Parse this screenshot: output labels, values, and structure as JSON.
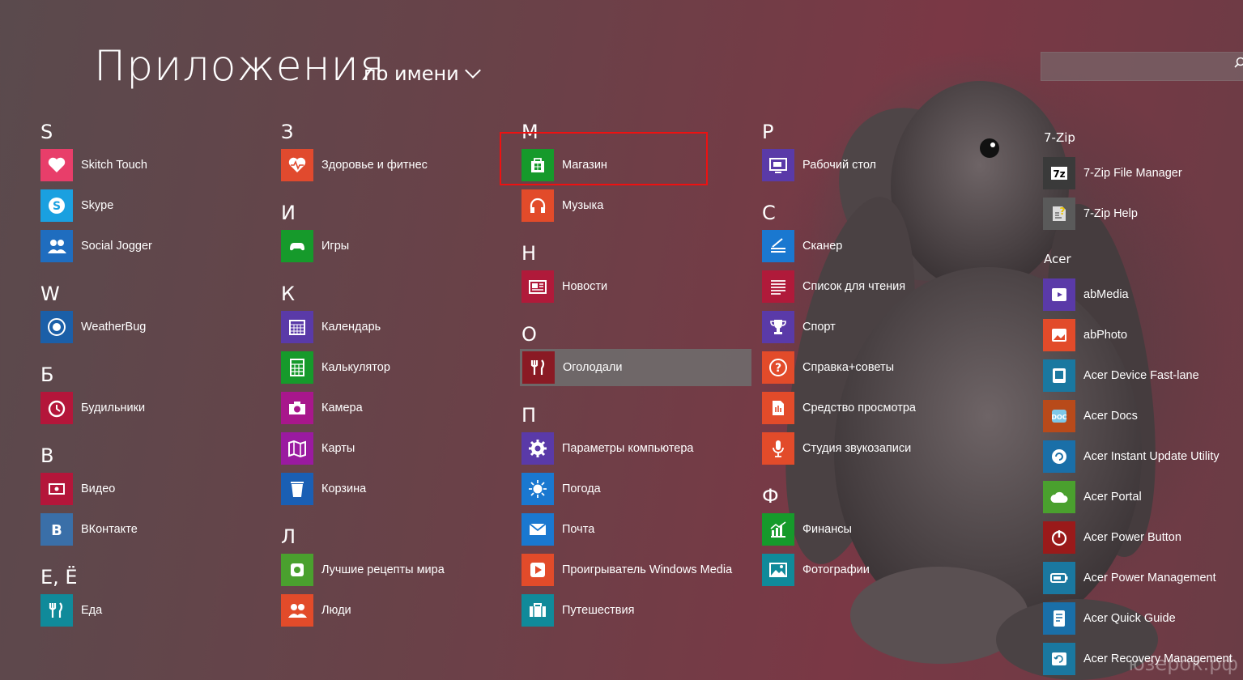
{
  "header": {
    "title": "Приложения",
    "sort_label": "по имени"
  },
  "search": {
    "placeholder": ""
  },
  "watermark": "юзерок.рф",
  "columns": [
    {
      "groups": [
        {
          "letter": "S",
          "apps": [
            {
              "label": "Skitch Touch",
              "color": "#e83e6a",
              "icon": "heart-icon"
            },
            {
              "label": "Skype",
              "color": "#1aa0e0",
              "icon": "skype-icon"
            },
            {
              "label": "Social Jogger",
              "color": "#1f6dbf",
              "icon": "people-icon"
            }
          ]
        },
        {
          "letter": "W",
          "apps": [
            {
              "label": "WeatherBug",
              "color": "#1b5fa8",
              "icon": "weatherbug-icon"
            }
          ]
        },
        {
          "letter": "Б",
          "apps": [
            {
              "label": "Будильники",
              "color": "#b4163a",
              "icon": "alarm-icon"
            }
          ]
        },
        {
          "letter": "В",
          "apps": [
            {
              "label": "Видео",
              "color": "#b4163a",
              "icon": "video-icon"
            },
            {
              "label": "ВКонтакте",
              "color": "#3a6fa8",
              "icon": "vk-icon"
            }
          ]
        },
        {
          "letter": "Е, Ё",
          "apps": [
            {
              "label": "Еда",
              "color": "#108a9a",
              "icon": "fork-knife-icon"
            }
          ]
        }
      ]
    },
    {
      "groups": [
        {
          "letter": "З",
          "apps": [
            {
              "label": "Здоровье и фитнес",
              "color": "#e14a2e",
              "icon": "heart-pulse-icon"
            }
          ]
        },
        {
          "letter": "И",
          "apps": [
            {
              "label": "Игры",
              "color": "#169a2b",
              "icon": "gamepad-icon"
            }
          ]
        },
        {
          "letter": "К",
          "apps": [
            {
              "label": "Календарь",
              "color": "#5a3aa8",
              "icon": "calendar-icon"
            },
            {
              "label": "Калькулятор",
              "color": "#169a2b",
              "icon": "calculator-icon"
            },
            {
              "label": "Камера",
              "color": "#a8178c",
              "icon": "camera-icon"
            },
            {
              "label": "Карты",
              "color": "#9a1aa0",
              "icon": "map-icon"
            },
            {
              "label": "Корзина",
              "color": "#1a5fb4",
              "icon": "recycle-bin-icon"
            }
          ]
        },
        {
          "letter": "Л",
          "apps": [
            {
              "label": "Лучшие рецепты мира",
              "color": "#4aa02e",
              "icon": "recipes-icon"
            },
            {
              "label": "Люди",
              "color": "#e24b2a",
              "icon": "people-icon"
            }
          ]
        }
      ]
    },
    {
      "groups": [
        {
          "letter": "М",
          "apps": [
            {
              "label": "Магазин",
              "color": "#169a2b",
              "icon": "store-icon"
            },
            {
              "label": "Музыка",
              "color": "#e24b2a",
              "icon": "headphones-icon"
            }
          ]
        },
        {
          "letter": "Н",
          "apps": [
            {
              "label": "Новости",
              "color": "#b01a3a",
              "icon": "news-icon"
            }
          ]
        },
        {
          "letter": "О",
          "apps": [
            {
              "label": "Оголодали",
              "color": "#8a1a24",
              "icon": "fork-knife-icon"
            }
          ]
        },
        {
          "letter": "П",
          "apps": [
            {
              "label": "Параметры компьютера",
              "color": "#5a3aa8",
              "icon": "gear-icon"
            },
            {
              "label": "Погода",
              "color": "#1a78d0",
              "icon": "sun-icon"
            },
            {
              "label": "Почта",
              "color": "#1a78d0",
              "icon": "mail-icon"
            },
            {
              "label": "Проигрыватель Windows Media",
              "color": "#e24b2a",
              "icon": "media-player-icon"
            },
            {
              "label": "Путешествия",
              "color": "#108a9a",
              "icon": "suitcase-icon"
            }
          ]
        }
      ]
    },
    {
      "groups": [
        {
          "letter": "Р",
          "apps": [
            {
              "label": "Рабочий стол",
              "color": "#5a3aa8",
              "icon": "desktop-icon"
            }
          ]
        },
        {
          "letter": "С",
          "apps": [
            {
              "label": "Сканер",
              "color": "#1a78d0",
              "icon": "scanner-icon"
            },
            {
              "label": "Список для чтения",
              "color": "#b01a3a",
              "icon": "reading-list-icon"
            },
            {
              "label": "Спорт",
              "color": "#5a3aa8",
              "icon": "trophy-icon"
            },
            {
              "label": "Справка+советы",
              "color": "#e24b2a",
              "icon": "help-icon"
            },
            {
              "label": "Средство просмотра",
              "color": "#e24b2a",
              "icon": "reader-icon"
            },
            {
              "label": "Студия звукозаписи",
              "color": "#e24b2a",
              "icon": "microphone-icon"
            }
          ]
        },
        {
          "letter": "Ф",
          "apps": [
            {
              "label": "Финансы",
              "color": "#169a2b",
              "icon": "finance-icon"
            },
            {
              "label": "Фотографии",
              "color": "#108a9a",
              "icon": "photos-icon"
            }
          ]
        }
      ]
    },
    {
      "groups": [
        {
          "letter": "7-Zip",
          "apps": [
            {
              "label": "7-Zip File Manager",
              "color": "#3a3a3a",
              "icon": "7zip-icon"
            },
            {
              "label": "7-Zip Help",
              "color": "#5a5a5a",
              "icon": "help-doc-icon"
            }
          ]
        },
        {
          "letter": "Acer",
          "apps": [
            {
              "label": "abMedia",
              "color": "#5a3aa8",
              "icon": "media-icon"
            },
            {
              "label": "abPhoto",
              "color": "#e24b2a",
              "icon": "photo-icon"
            },
            {
              "label": "Acer Device Fast-lane",
              "color": "#1a78a0",
              "icon": "device-icon"
            },
            {
              "label": "Acer Docs",
              "color": "#b84a1a",
              "icon": "docs-icon"
            },
            {
              "label": "Acer Instant Update Utility",
              "color": "#1a6fa8",
              "icon": "update-icon"
            },
            {
              "label": "Acer Portal",
              "color": "#4aa02e",
              "icon": "cloud-icon"
            },
            {
              "label": "Acer Power Button",
              "color": "#9a1a1a",
              "icon": "power-icon"
            },
            {
              "label": "Acer Power Management",
              "color": "#1a78a0",
              "icon": "battery-icon"
            },
            {
              "label": "Acer Quick Guide",
              "color": "#1a6fa8",
              "icon": "guide-icon"
            },
            {
              "label": "Acer Recovery Management",
              "color": "#1a78a0",
              "icon": "recovery-icon"
            }
          ]
        }
      ]
    }
  ]
}
